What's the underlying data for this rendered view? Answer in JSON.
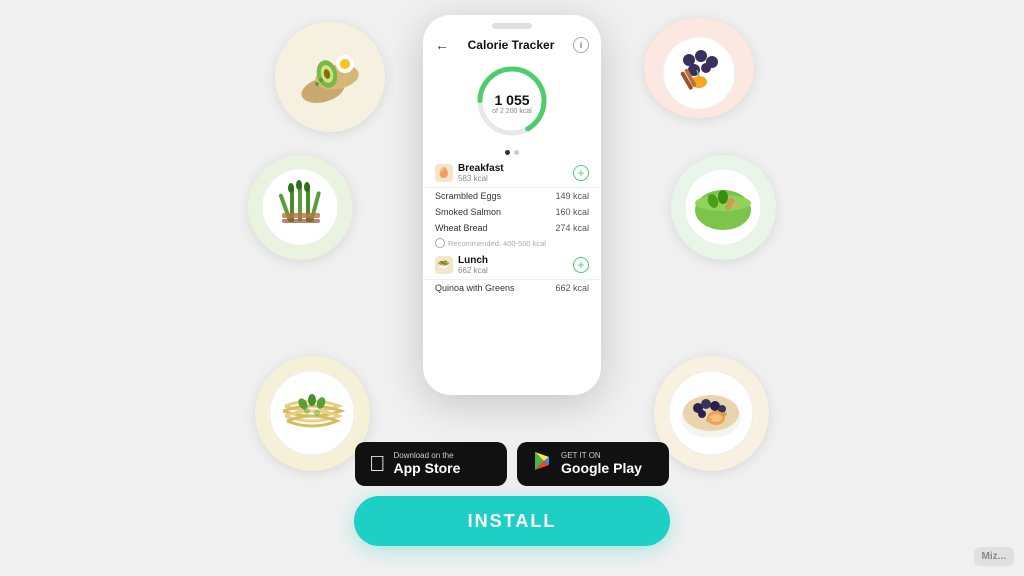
{
  "app": {
    "header": {
      "back_icon": "←",
      "title": "Calorie Tracker",
      "info_icon": "i"
    },
    "calorie": {
      "current": "1 055",
      "total_label": "of 2 200 kcal"
    },
    "meals": [
      {
        "name": "Breakfast",
        "kcal": "583 kcal",
        "icon": "🥚",
        "items": [
          {
            "name": "Scrambled Eggs",
            "kcal": "149 kcal"
          },
          {
            "name": "Smoked Salmon",
            "kcal": "160 kcal"
          },
          {
            "name": "Wheat Bread",
            "kcal": "274 kcal"
          }
        ],
        "recommended": "Recommended: 400-500 kcal"
      },
      {
        "name": "Lunch",
        "kcal": "662 kcal",
        "icon": "🥗",
        "items": [
          {
            "name": "Quinoa with Greens",
            "kcal": "662 kcal"
          }
        ]
      }
    ],
    "store_buttons": {
      "apple": {
        "top": "Download on the",
        "bottom": "App Store"
      },
      "google": {
        "top": "GET IT ON",
        "bottom": "Google Play"
      }
    },
    "install_label": "INSTALL",
    "watermark": "Miz..."
  }
}
